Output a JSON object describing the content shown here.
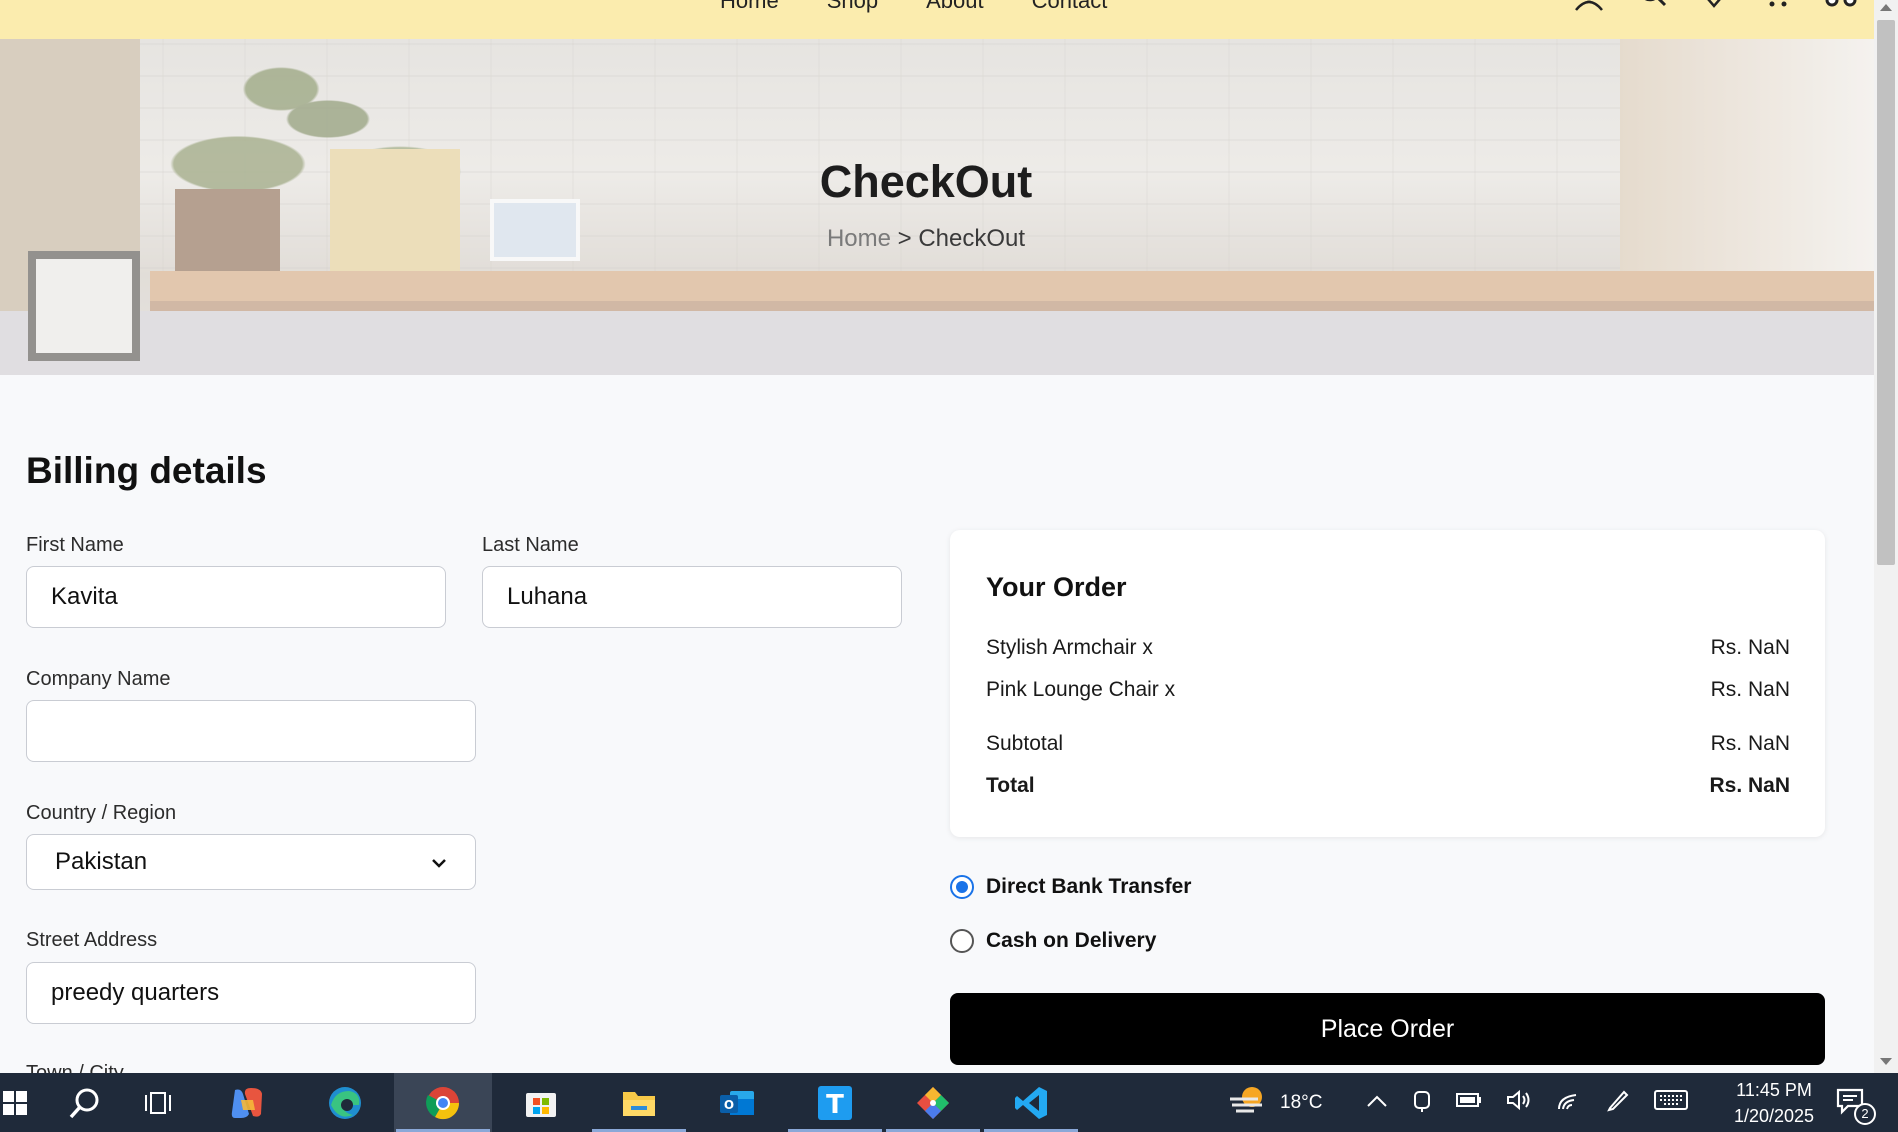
{
  "nav": {
    "links": [
      "Home",
      "Shop",
      "About",
      "Contact"
    ]
  },
  "hero": {
    "title": "CheckOut",
    "breadcrumb_home": "Home",
    "breadcrumb_sep": ">",
    "breadcrumb_current": "CheckOut"
  },
  "billing": {
    "title": "Billing details",
    "first_name_label": "First Name",
    "first_name_value": "Kavita",
    "last_name_label": "Last Name",
    "last_name_value": "Luhana",
    "company_label": "Company Name",
    "company_value": "",
    "country_label": "Country / Region",
    "country_value": "Pakistan",
    "street_label": "Street Address",
    "street_value": "preedy quarters",
    "town_label": "Town / City"
  },
  "order": {
    "title": "Your Order",
    "items": [
      {
        "name": "Stylish Armchair x",
        "price": "Rs. NaN"
      },
      {
        "name": "Pink Lounge Chair x",
        "price": "Rs. NaN"
      }
    ],
    "subtotal_label": "Subtotal",
    "subtotal_value": "Rs. NaN",
    "total_label": "Total",
    "total_value": "Rs. NaN"
  },
  "payment": {
    "options": [
      {
        "label": "Direct Bank Transfer",
        "selected": true
      },
      {
        "label": "Cash on Delivery",
        "selected": false
      }
    ],
    "place_order_label": "Place Order"
  },
  "taskbar": {
    "apps": [
      "start",
      "search",
      "task-view",
      "copilot",
      "edge",
      "chrome",
      "microsoft-store",
      "file-explorer",
      "outlook",
      "text-app",
      "git-tool",
      "vs-code"
    ],
    "weather": "18°C",
    "time": "11:45 PM",
    "date": "1/20/2025",
    "notification_count": "2"
  },
  "colors": {
    "navbar_bg": "#fbecae",
    "page_bg": "#f8f9fb",
    "radio_accent": "#1a73e8",
    "button_bg": "#000000",
    "taskbar_bg": "#1f2a3a"
  }
}
